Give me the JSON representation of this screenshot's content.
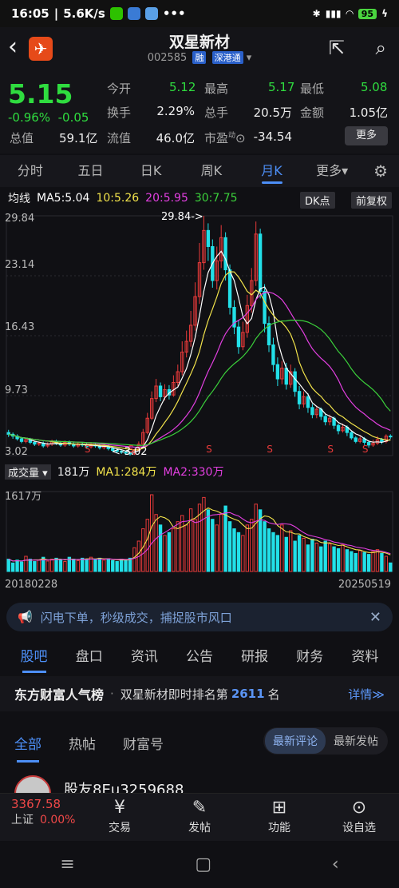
{
  "status": {
    "time": "16:05",
    "speed": "5.6K/s",
    "battery": "95"
  },
  "header": {
    "title": "双星新材",
    "code": "002585",
    "tag1": "融",
    "tag2": "深港通"
  },
  "quote": {
    "price": "5.15",
    "change_pct": "-0.96%",
    "change": "-0.05",
    "total_mcap_label": "总值",
    "total_mcap": "59.1亿",
    "open_label": "今开",
    "open": "5.12",
    "high_label": "最高",
    "high": "5.17",
    "low_label": "最低",
    "low": "5.08",
    "turnover_label": "换手",
    "turnover": "2.29%",
    "volume_label": "总手",
    "volume": "20.5万",
    "amount_label": "金额",
    "amount": "1.05亿",
    "float_label": "流值",
    "float_mcap": "46.0亿",
    "pe_label": "市盈",
    "pe_sup": "动",
    "pe": "-34.54",
    "more_label": "更多"
  },
  "period_tabs": [
    "分时",
    "五日",
    "日K",
    "周K",
    "月K",
    "更多▾"
  ],
  "period_active": 4,
  "ma": {
    "label": "均线",
    "ma5": "MA5:5.04",
    "ma10": "10:5.26",
    "ma20": "20:5.95",
    "ma30": "30:7.75",
    "dk_label": "DK点",
    "adj_label": "前复权"
  },
  "chart_labels": {
    "y_ticks": [
      "29.84",
      "23.14",
      "16.43",
      "9.73",
      "3.02"
    ],
    "max_label": "29.84->",
    "min_label": "<-3.02",
    "vol_label": "成交量",
    "vol_value": "181万",
    "vol_ma1": "MA1:284万",
    "vol_ma2": "MA2:330万",
    "vol_max": "1617万",
    "date_start": "20180228",
    "date_end": "20250519",
    "sell_mark": "S"
  },
  "promo": {
    "text": "闪电下单，秒级成交，捕捉股市风口"
  },
  "section_tabs": [
    "股吧",
    "盘口",
    "资讯",
    "公告",
    "研报",
    "财务",
    "资料"
  ],
  "section_active": 0,
  "rank": {
    "brand": "东方财富人气榜",
    "prefix": "双星新材即时排名第",
    "num": "2611",
    "suffix": "名",
    "detail": "详情≫"
  },
  "content_tabs": [
    "全部",
    "热帖",
    "财富号"
  ],
  "content_active": 0,
  "sort": {
    "latest_comment": "最新评论",
    "latest_post": "最新发帖"
  },
  "post": {
    "user": "股友8Eu3259688"
  },
  "bottom": {
    "index_value": "3367.58",
    "index_name": "上证",
    "index_pct": "0.00%",
    "items": [
      "交易",
      "发帖",
      "功能",
      "设自选"
    ]
  },
  "colors": {
    "up": "#e83a3a",
    "down": "#22e0e8",
    "price_down": "#2fdc3f",
    "accent": "#4d8ff7",
    "ma5": "#ffffff",
    "ma10": "#f2e34b",
    "ma20": "#e23fe0",
    "ma30": "#3bd13b"
  },
  "chart_data": {
    "type": "candlestick",
    "title": "双星新材 月K",
    "ylim": [
      3.02,
      29.84
    ],
    "series_high": 29.84,
    "series_low": 3.02,
    "candles": [
      [
        5.6,
        5.4,
        5.9,
        5.1
      ],
      [
        5.4,
        5.2,
        5.6,
        4.9
      ],
      [
        5.2,
        4.9,
        5.4,
        4.7
      ],
      [
        4.9,
        4.6,
        5.1,
        4.4
      ],
      [
        4.6,
        4.8,
        5.0,
        4.4
      ],
      [
        4.8,
        4.5,
        5.0,
        4.3
      ],
      [
        4.5,
        4.3,
        4.7,
        4.1
      ],
      [
        4.3,
        4.4,
        4.6,
        4.1
      ],
      [
        4.4,
        4.1,
        4.6,
        3.9
      ],
      [
        4.1,
        4.3,
        4.5,
        3.9
      ],
      [
        4.3,
        4.6,
        4.8,
        4.1
      ],
      [
        4.6,
        4.4,
        4.8,
        4.2
      ],
      [
        4.4,
        4.2,
        4.6,
        4.0
      ],
      [
        4.2,
        4.5,
        4.7,
        4.0
      ],
      [
        4.5,
        4.3,
        4.7,
        4.1
      ],
      [
        4.3,
        4.1,
        4.5,
        3.9
      ],
      [
        4.1,
        4.3,
        4.5,
        3.9
      ],
      [
        4.3,
        4.2,
        4.5,
        4.0
      ],
      [
        4.2,
        4.0,
        4.4,
        3.8
      ],
      [
        4.0,
        4.2,
        4.4,
        3.8
      ],
      [
        4.2,
        4.1,
        4.4,
        3.9
      ],
      [
        4.1,
        3.9,
        4.3,
        3.7
      ],
      [
        3.9,
        4.1,
        4.3,
        3.7
      ],
      [
        4.1,
        3.8,
        4.3,
        3.6
      ],
      [
        3.8,
        3.6,
        4.0,
        3.4
      ],
      [
        3.6,
        3.5,
        3.8,
        3.3
      ],
      [
        3.5,
        3.4,
        3.7,
        3.2
      ],
      [
        3.4,
        3.3,
        3.6,
        3.1
      ],
      [
        3.3,
        3.2,
        3.5,
        3.02
      ],
      [
        3.2,
        3.6,
        3.8,
        3.1
      ],
      [
        3.6,
        4.3,
        4.6,
        3.5
      ],
      [
        4.3,
        5.6,
        6.0,
        4.2
      ],
      [
        5.6,
        7.2,
        7.8,
        5.4
      ],
      [
        7.2,
        9.4,
        10.2,
        7.0
      ],
      [
        9.4,
        10.8,
        11.6,
        9.0
      ],
      [
        10.8,
        9.6,
        11.2,
        9.1
      ],
      [
        9.6,
        10.4,
        11.0,
        9.2
      ],
      [
        10.4,
        9.8,
        10.9,
        9.3
      ],
      [
        9.8,
        11.2,
        12.0,
        9.6
      ],
      [
        11.2,
        12.4,
        13.2,
        10.8
      ],
      [
        12.4,
        14.6,
        15.8,
        12.0
      ],
      [
        14.6,
        15.8,
        17.0,
        14.0
      ],
      [
        15.8,
        17.6,
        19.2,
        15.2
      ],
      [
        17.6,
        20.8,
        22.4,
        17.0
      ],
      [
        20.8,
        24.6,
        26.8,
        20.0
      ],
      [
        24.6,
        28.2,
        29.84,
        23.8
      ],
      [
        28.2,
        26.4,
        29.0,
        24.8
      ],
      [
        26.4,
        22.6,
        27.2,
        21.8
      ],
      [
        22.6,
        24.8,
        26.4,
        21.6
      ],
      [
        24.8,
        27.4,
        28.8,
        24.0
      ],
      [
        27.4,
        23.8,
        28.0,
        22.6
      ],
      [
        23.8,
        19.6,
        24.4,
        18.8
      ],
      [
        19.6,
        17.4,
        20.4,
        16.6
      ],
      [
        17.4,
        15.2,
        18.2,
        14.4
      ],
      [
        15.2,
        16.8,
        18.0,
        14.8
      ],
      [
        16.8,
        19.8,
        21.0,
        16.2
      ],
      [
        19.8,
        22.6,
        24.0,
        19.0
      ],
      [
        22.6,
        27.8,
        29.2,
        22.0
      ],
      [
        27.8,
        21.4,
        28.4,
        20.6
      ],
      [
        21.4,
        17.8,
        22.2,
        16.8
      ],
      [
        17.8,
        15.4,
        18.6,
        14.6
      ],
      [
        15.4,
        13.2,
        16.2,
        12.4
      ],
      [
        13.2,
        11.6,
        14.0,
        10.8
      ],
      [
        11.6,
        12.8,
        13.6,
        11.0
      ],
      [
        12.8,
        11.0,
        13.4,
        10.4
      ],
      [
        11.0,
        12.4,
        13.2,
        10.6
      ],
      [
        12.4,
        10.2,
        12.8,
        9.6
      ],
      [
        10.2,
        8.8,
        10.8,
        8.2
      ],
      [
        8.8,
        9.6,
        10.2,
        8.4
      ],
      [
        9.6,
        8.4,
        10.0,
        7.8
      ],
      [
        8.4,
        7.6,
        8.8,
        7.2
      ],
      [
        7.6,
        8.2,
        8.6,
        7.2
      ],
      [
        8.2,
        7.4,
        8.4,
        7.0
      ],
      [
        7.4,
        6.8,
        7.8,
        6.4
      ],
      [
        6.8,
        7.2,
        7.6,
        6.4
      ],
      [
        7.2,
        6.4,
        7.4,
        6.0
      ],
      [
        6.4,
        5.8,
        6.6,
        5.4
      ],
      [
        5.8,
        6.2,
        6.6,
        5.6
      ],
      [
        6.2,
        5.6,
        6.4,
        5.2
      ],
      [
        5.6,
        5.0,
        5.8,
        4.8
      ],
      [
        5.0,
        4.6,
        5.2,
        4.4
      ],
      [
        4.6,
        4.9,
        5.2,
        4.4
      ],
      [
        4.9,
        4.5,
        5.1,
        4.2
      ],
      [
        4.5,
        4.2,
        4.7,
        3.9
      ],
      [
        4.2,
        4.4,
        4.8,
        4.0
      ],
      [
        4.4,
        4.8,
        5.2,
        4.2
      ],
      [
        4.8,
        4.6,
        5.0,
        4.3
      ],
      [
        4.6,
        5.2,
        5.4,
        4.4
      ],
      [
        5.2,
        5.15,
        5.4,
        4.9
      ]
    ],
    "volumes": [
      260,
      180,
      240,
      200,
      320,
      260,
      210,
      240,
      300,
      220,
      260,
      280,
      240,
      210,
      300,
      260,
      230,
      280,
      260,
      300,
      250,
      280,
      240,
      270,
      230,
      210,
      260,
      240,
      280,
      500,
      640,
      900,
      1100,
      1617,
      1200,
      980,
      760,
      820,
      900,
      1050,
      1180,
      980,
      1320,
      1100,
      1420,
      1560,
      1300,
      1100,
      980,
      1200,
      1380,
      1050,
      900,
      820,
      760,
      980,
      1100,
      1420,
      1300,
      1050,
      900,
      820,
      760,
      980,
      720,
      860,
      640,
      760,
      700,
      560,
      680,
      600,
      520,
      640,
      580,
      520,
      480,
      560,
      460,
      420,
      380,
      440,
      400,
      360,
      420,
      460,
      380,
      320,
      181
    ]
  }
}
